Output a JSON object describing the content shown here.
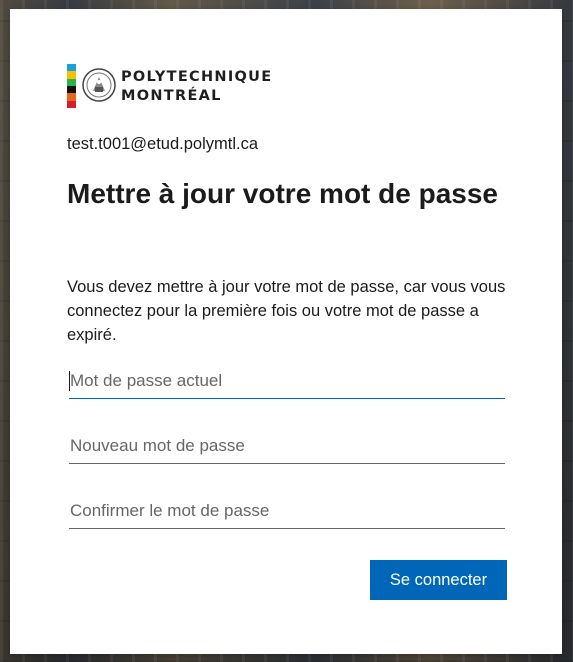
{
  "brand": {
    "name_line1": "POLYTECHNIQUE",
    "name_line2": "MONTRÉAL",
    "bar_colors": [
      "#1aa0dc",
      "#f3c300",
      "#2cb24a",
      "#111111",
      "#e8651c",
      "#d21f2b"
    ]
  },
  "account": {
    "email": "test.t001@etud.polymtl.ca"
  },
  "page": {
    "title": "Mettre à jour votre mot de passe",
    "description": "Vous devez mettre à jour votre mot de passe, car vous vous connectez pour la première fois ou votre mot de passe a expiré."
  },
  "form": {
    "current_password": {
      "placeholder": "Mot de passe actuel",
      "value": ""
    },
    "new_password": {
      "placeholder": "Nouveau mot de passe",
      "value": ""
    },
    "confirm_password": {
      "placeholder": "Confirmer le mot de passe",
      "value": ""
    },
    "submit_label": "Se connecter"
  },
  "colors": {
    "accent": "#0067b8",
    "text": "#1b1b1b",
    "placeholder": "#666666"
  }
}
